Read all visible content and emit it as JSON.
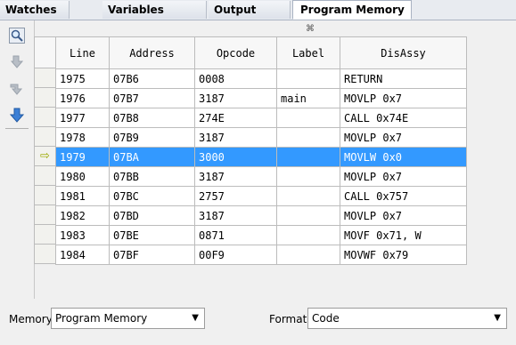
{
  "tabs": [
    {
      "label": "Watches"
    },
    {
      "label": "Variables"
    },
    {
      "label": "Output"
    },
    {
      "label": "Program Memory",
      "close": "⌘"
    }
  ],
  "toolbar": {
    "icons": [
      "magnifier-icon",
      "step-into-icon",
      "step-over-icon",
      "step-down-icon"
    ]
  },
  "table": {
    "columns": [
      "Line",
      "Address",
      "Opcode",
      "Label",
      "DisAssy"
    ],
    "rows": [
      {
        "line": "1975",
        "address": "07B6",
        "opcode": "0008",
        "label": "",
        "disassy": "RETURN"
      },
      {
        "line": "1976",
        "address": "07B7",
        "opcode": "3187",
        "label": "main",
        "disassy": "MOVLP 0x7"
      },
      {
        "line": "1977",
        "address": "07B8",
        "opcode": "274E",
        "label": "",
        "disassy": "CALL 0x74E"
      },
      {
        "line": "1978",
        "address": "07B9",
        "opcode": "3187",
        "label": "",
        "disassy": "MOVLP 0x7"
      },
      {
        "line": "1979",
        "address": "07BA",
        "opcode": "3000",
        "label": "",
        "disassy": "MOVLW 0x0"
      },
      {
        "line": "1980",
        "address": "07BB",
        "opcode": "3187",
        "label": "",
        "disassy": "MOVLP 0x7"
      },
      {
        "line": "1981",
        "address": "07BC",
        "opcode": "2757",
        "label": "",
        "disassy": "CALL 0x757"
      },
      {
        "line": "1982",
        "address": "07BD",
        "opcode": "3187",
        "label": "",
        "disassy": "MOVLP 0x7"
      },
      {
        "line": "1983",
        "address": "07BE",
        "opcode": "0871",
        "label": "",
        "disassy": "MOVF 0x71, W"
      },
      {
        "line": "1984",
        "address": "07BF",
        "opcode": "00F9",
        "label": "",
        "disassy": "MOVWF 0x79"
      }
    ],
    "selected_line": "1979",
    "pc_arrow": "⇨"
  },
  "memory": {
    "label": "Memory",
    "value": "Program Memory"
  },
  "format": {
    "label": "Format",
    "value": "Code"
  },
  "colors": {
    "selection": "#3399ff",
    "arrow": "#9aa800"
  }
}
